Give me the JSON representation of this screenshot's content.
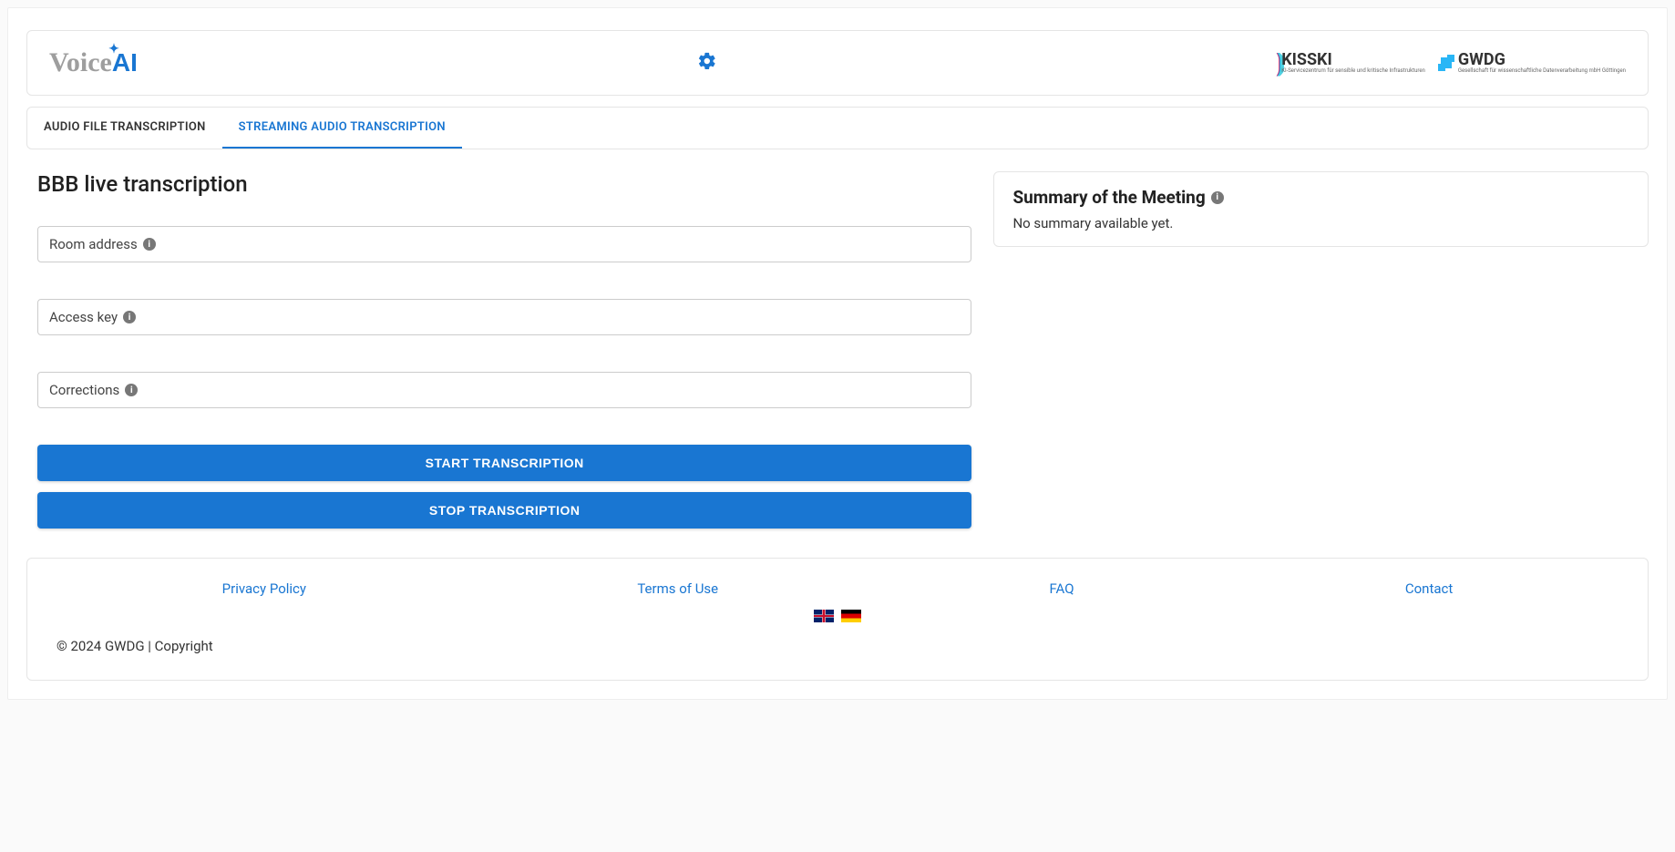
{
  "header": {
    "logo_text_main": "Voice",
    "logo_text_ai": "AI",
    "kisski_label": "KISSKI",
    "kisski_sub": "KI-Servicezentrum für sensible und kritische Infrastrukturen",
    "gwdg_label": "GWDG",
    "gwdg_sub": "Gesellschaft für wissenschaftliche Datenverarbeitung mbH Göttingen"
  },
  "tabs": {
    "audio_file": "AUDIO FILE TRANSCRIPTION",
    "streaming": "STREAMING AUDIO TRANSCRIPTION"
  },
  "main": {
    "title": "BBB live transcription",
    "fields": {
      "room_address_label": "Room address",
      "room_address_value": "",
      "access_key_label": "Access key",
      "access_key_value": "",
      "corrections_label": "Corrections",
      "corrections_value": ""
    },
    "buttons": {
      "start": "START TRANSCRIPTION",
      "stop": "STOP TRANSCRIPTION"
    }
  },
  "summary": {
    "title": "Summary of the Meeting",
    "body": "No summary available yet."
  },
  "footer": {
    "links": {
      "privacy": "Privacy Policy",
      "terms": "Terms of Use",
      "faq": "FAQ",
      "contact": "Contact"
    },
    "copyright": "© 2024 GWDG | Copyright"
  }
}
